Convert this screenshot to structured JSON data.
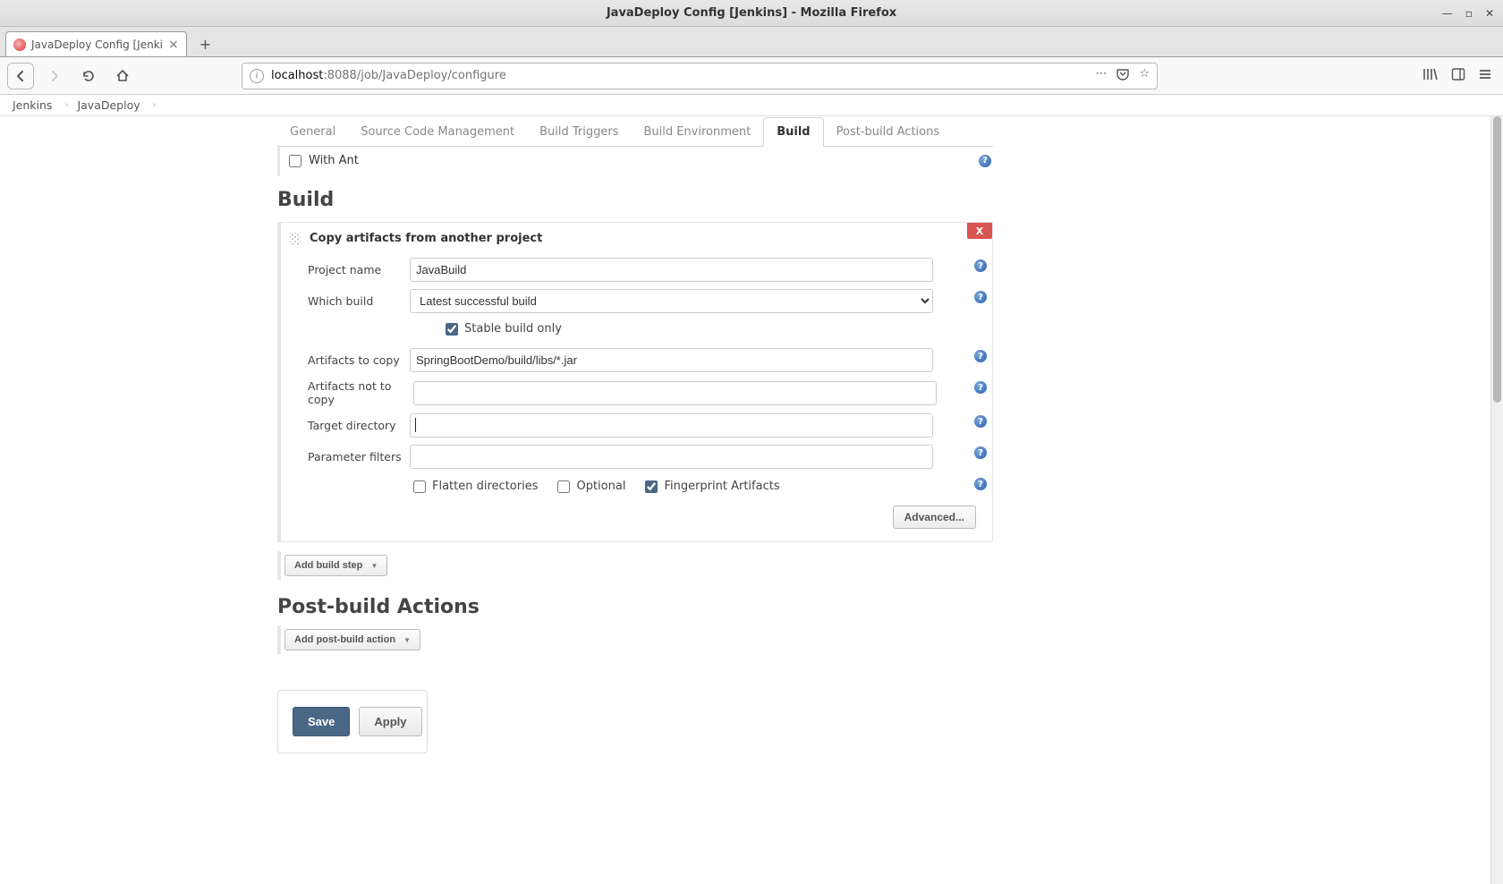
{
  "window": {
    "title": "JavaDeploy Config [Jenkins] - Mozilla Firefox"
  },
  "tab": {
    "title": "JavaDeploy Config [Jenki"
  },
  "url": {
    "host": "localhost",
    "port_path": ":8088/job/JavaDeploy/configure"
  },
  "breadcrumbs": {
    "root": "Jenkins",
    "job": "JavaDeploy"
  },
  "config_tabs": {
    "general": "General",
    "scm": "Source Code Management",
    "triggers": "Build Triggers",
    "env": "Build Environment",
    "build": "Build",
    "post": "Post-build Actions"
  },
  "with_ant": {
    "label": "With Ant",
    "checked": false
  },
  "section_build": "Build",
  "copy_artifacts": {
    "title": "Copy artifacts from another project",
    "delete_label": "X",
    "project_name": {
      "label": "Project name",
      "value": "JavaBuild"
    },
    "which_build": {
      "label": "Which build",
      "value": "Latest successful build"
    },
    "stable_only": {
      "label": "Stable build only",
      "checked": true
    },
    "artifacts_to_copy": {
      "label": "Artifacts to copy",
      "value": "SpringBootDemo/build/libs/*.jar"
    },
    "artifacts_not_to_copy": {
      "label": "Artifacts not to copy",
      "value": ""
    },
    "target_directory": {
      "label": "Target directory",
      "value": ""
    },
    "parameter_filters": {
      "label": "Parameter filters",
      "value": ""
    },
    "flatten": {
      "label": "Flatten directories",
      "checked": false
    },
    "optional": {
      "label": "Optional",
      "checked": false
    },
    "fingerprint": {
      "label": "Fingerprint Artifacts",
      "checked": true
    },
    "advanced": "Advanced..."
  },
  "add_build_step": "Add build step",
  "section_post": "Post-build Actions",
  "add_post_build": "Add post-build action",
  "buttons": {
    "save": "Save",
    "apply": "Apply"
  }
}
